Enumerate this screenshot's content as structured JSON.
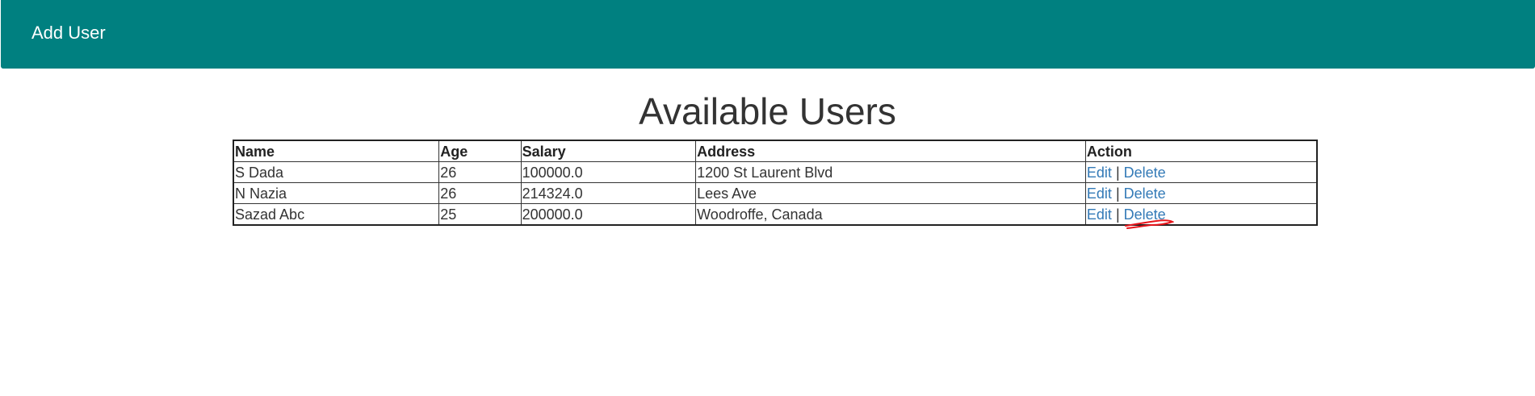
{
  "navbar": {
    "add_user_label": "Add User",
    "background_color": "#008080"
  },
  "page": {
    "title": "Available Users"
  },
  "table": {
    "headers": {
      "name": "Name",
      "age": "Age",
      "salary": "Salary",
      "address": "Address",
      "action": "Action"
    },
    "rows": [
      {
        "name": "S Dada",
        "age": "26",
        "salary": "100000.0",
        "address": "1200 St Laurent Blvd",
        "edit": "Edit",
        "separator": "|",
        "delete": "Delete"
      },
      {
        "name": "N Nazia",
        "age": "26",
        "salary": "214324.0",
        "address": "Lees Ave",
        "edit": "Edit",
        "separator": "|",
        "delete": "Delete"
      },
      {
        "name": "Sazad Abc",
        "age": "25",
        "salary": "200000.0",
        "address": "Woodroffe, Canada",
        "edit": "Edit",
        "separator": "|",
        "delete": "Delete"
      }
    ]
  },
  "colors": {
    "link": "#337ab7",
    "annotation": "#e8151b"
  }
}
